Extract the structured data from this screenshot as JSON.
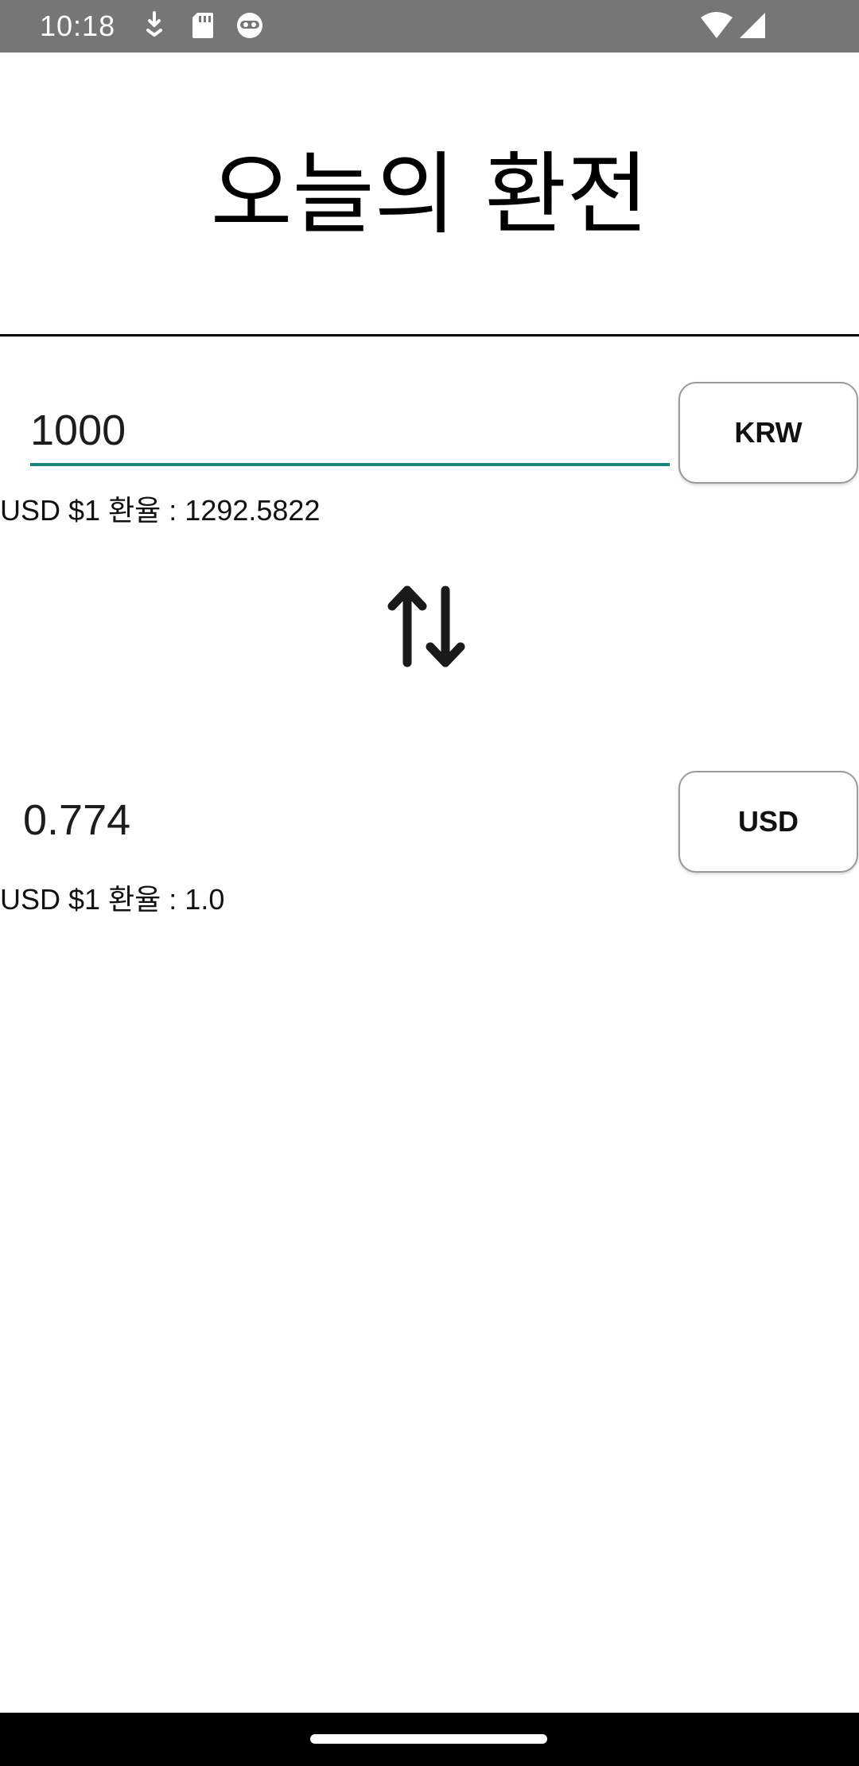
{
  "status_bar": {
    "time": "10:18",
    "icons": [
      "download-icon",
      "sd-card-icon",
      "android-icon",
      "wifi-icon",
      "cellular-signal-icon"
    ]
  },
  "title": "오늘의 환전",
  "source": {
    "amount": "1000",
    "currency_label": "KRW",
    "rate_text": "USD $1 환율 : 1292.5822"
  },
  "swap_icon": "swap-vertical-icon",
  "target": {
    "amount": "0.774",
    "currency_label": "USD",
    "rate_text": "USD $1 환율 : 1.0"
  },
  "colors": {
    "status_bar": "#767676",
    "input_underline": "#198577",
    "nav_bar": "#000000"
  }
}
